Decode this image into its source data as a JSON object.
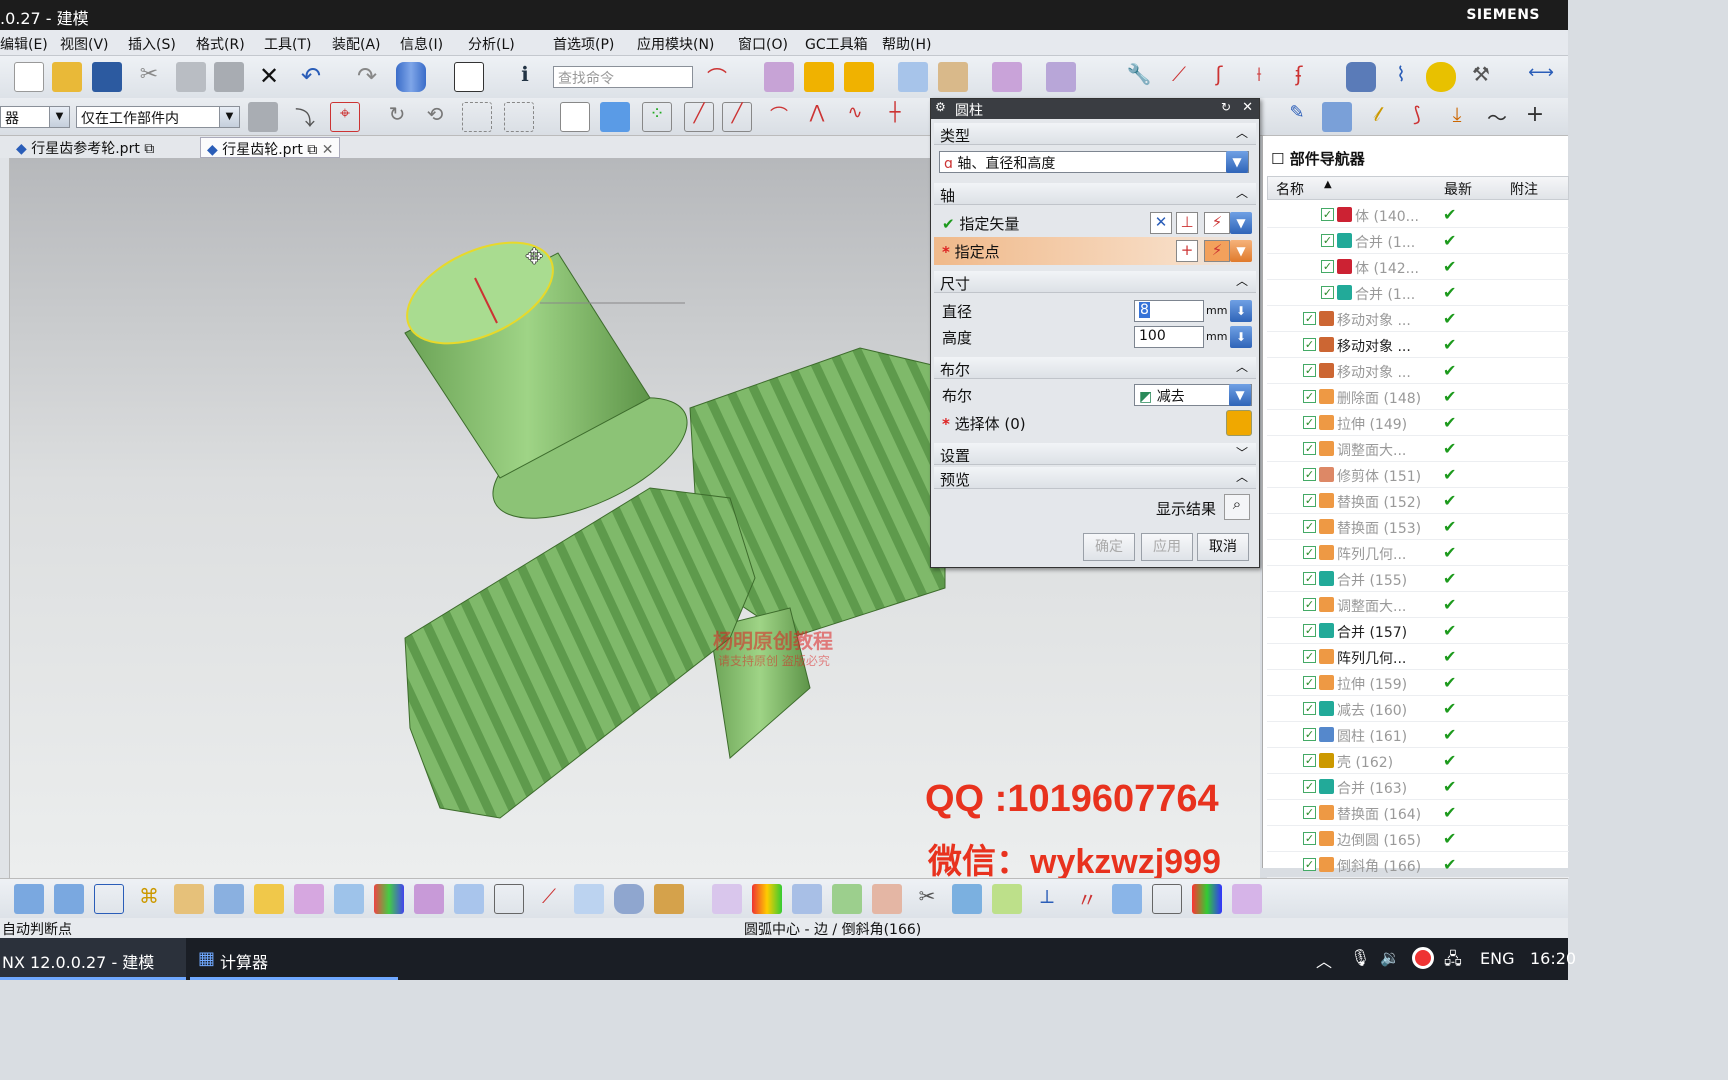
{
  "window": {
    "title": ".0.27 - 建模",
    "brand": "SIEMENS"
  },
  "menu": [
    "编辑(E)",
    "视图(V)",
    "插入(S)",
    "格式(R)",
    "工具(T)",
    "装配(A)",
    "信息(I)",
    "分析(L)",
    "首选项(P)",
    "应用模块(N)",
    "窗口(O)",
    "GC工具箱",
    "帮助(H)"
  ],
  "toolbar": {
    "search_placeholder": "查找命令",
    "filter_combo": "器",
    "scope_combo": "仅在工作部件内"
  },
  "tabs": [
    {
      "label": "行星齿参考轮.prt"
    },
    {
      "label": "行星齿轮.prt",
      "active": true
    }
  ],
  "viewport": {
    "watermark_line1": "杨明原创教程",
    "watermark_line2": "请支持原创 盗版必究",
    "qq": "QQ :1019607764",
    "wechat": "微信：wykzwzj999"
  },
  "dialog": {
    "title": "圆柱",
    "section_type": "类型",
    "type_value": "轴、直径和高度",
    "section_axis": "轴",
    "specify_vector": "指定矢量",
    "specify_point": "指定点",
    "section_dims": "尺寸",
    "diameter_label": "直径",
    "diameter_value": "8",
    "height_label": "高度",
    "height_value": "100",
    "unit": "mm",
    "section_bool": "布尔",
    "bool_label": "布尔",
    "bool_value": "减去",
    "select_body": "选择体 (0)",
    "section_settings": "设置",
    "section_preview": "预览",
    "show_result": "显示结果",
    "ok": "确定",
    "apply": "应用",
    "cancel": "取消"
  },
  "navigator": {
    "title": "部件导航器",
    "col_name": "名称",
    "col_latest": "最新",
    "col_note": "附注",
    "rows": [
      {
        "label": "体 (140...",
        "indent": 2,
        "active": false
      },
      {
        "label": "合并 (1...",
        "indent": 2,
        "active": false
      },
      {
        "label": "体 (142...",
        "indent": 2,
        "active": false
      },
      {
        "label": "合并 (1...",
        "indent": 2,
        "active": false
      },
      {
        "label": "移动对象 ...",
        "indent": 1,
        "active": false
      },
      {
        "label": "移动对象 ...",
        "indent": 1,
        "active": true
      },
      {
        "label": "移动对象 ...",
        "indent": 1,
        "active": false
      },
      {
        "label": "删除面 (148)",
        "indent": 1,
        "active": false
      },
      {
        "label": "拉伸 (149)",
        "indent": 1,
        "active": false
      },
      {
        "label": "调整面大...",
        "indent": 1,
        "active": false
      },
      {
        "label": "修剪体 (151)",
        "indent": 1,
        "active": false
      },
      {
        "label": "替换面 (152)",
        "indent": 1,
        "active": false
      },
      {
        "label": "替换面 (153)",
        "indent": 1,
        "active": false
      },
      {
        "label": "阵列几何...",
        "indent": 1,
        "active": false
      },
      {
        "label": "合并 (155)",
        "indent": 1,
        "active": false
      },
      {
        "label": "调整面大...",
        "indent": 1,
        "active": false
      },
      {
        "label": "合并 (157)",
        "indent": 1,
        "active": true
      },
      {
        "label": "阵列几何...",
        "indent": 1,
        "active": true
      },
      {
        "label": "拉伸 (159)",
        "indent": 1,
        "active": false
      },
      {
        "label": "减去 (160)",
        "indent": 1,
        "active": false
      },
      {
        "label": "圆柱 (161)",
        "indent": 1,
        "active": false
      },
      {
        "label": "壳 (162)",
        "indent": 1,
        "active": false
      },
      {
        "label": "合并 (163)",
        "indent": 1,
        "active": false
      },
      {
        "label": "替换面 (164)",
        "indent": 1,
        "active": false
      },
      {
        "label": "边倒圆 (165)",
        "indent": 1,
        "active": false
      },
      {
        "label": "倒斜角 (166)",
        "indent": 1,
        "active": false
      }
    ]
  },
  "status": {
    "left": "自动判断点",
    "center": "圆弧中心 - 边 / 倒斜角(166)"
  },
  "taskbar": {
    "app1": "NX 12.0.0.27 - 建模",
    "app2": "计算器",
    "lang": "ENG",
    "time": "16:20"
  },
  "colors": {
    "gear": "#7fb96a",
    "accent": "#e8321e",
    "titlebar": "#1c1c1c",
    "highlight_row": "#f0b98a"
  }
}
